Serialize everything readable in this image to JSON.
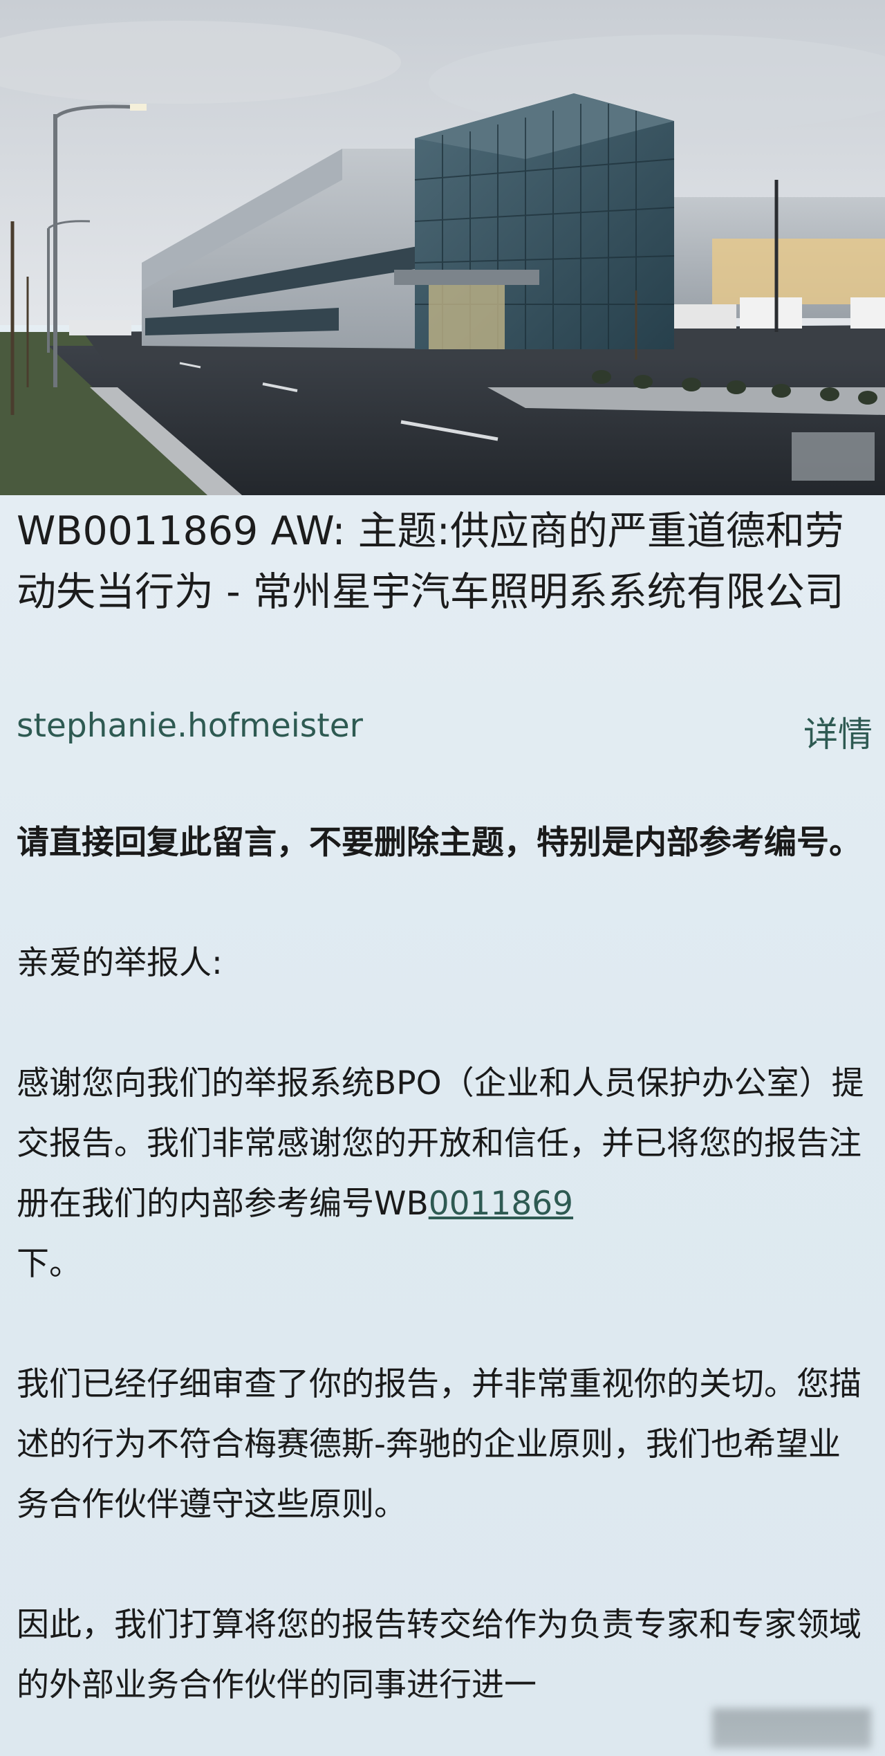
{
  "email": {
    "subject": "WB0011869 AW: 主题:供应商的严重道德和劳动失当行为 - 常州星宇汽车照明系系统有限公司",
    "sender": "stephanie.hofmeister",
    "details_label": "详情"
  },
  "body": {
    "notice": "请直接回复此留言，不要删除主题，特别是内部参考编号。",
    "greeting": "亲爱的举报人:",
    "p1_prefix": "感谢您向我们的举报系统BPO（企业和人员保护办公室）提交报告。我们非常感谢您的开放和信任，并已将您的报告注册在我们的内部参考编号WB",
    "p1_ref_link": "0011869",
    "p1_suffix": "下。",
    "p2": "我们已经仔细审查了你的报告，并非常重视你的关切。您描述的行为不符合梅赛德斯-奔驰的企业原则，我们也希望业务合作伙伴遵守这些原则。",
    "p3": "因此，我们打算将您的报告转交给作为负责专家和专家领域的外部业务合作伙伴的同事进行进一"
  },
  "colors": {
    "link": "#2e5a52",
    "text": "#1a1a1a",
    "background": "#e4edf3"
  }
}
